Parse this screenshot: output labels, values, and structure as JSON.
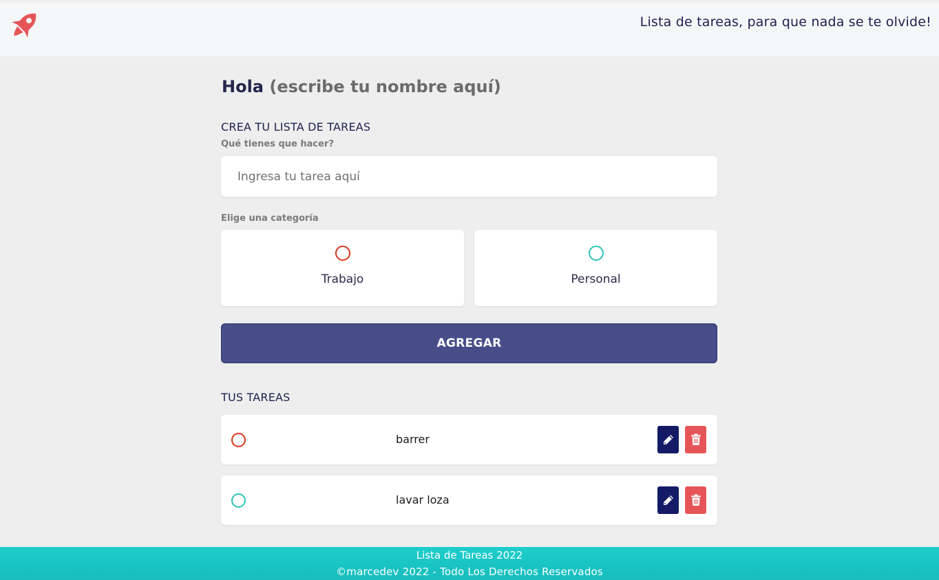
{
  "header": {
    "logo_icon": "rocket-icon",
    "tagline": "Lista de tareas, para que nada se te olvide!",
    "accent_color": "#e55557"
  },
  "greeting": {
    "hello": "Hola",
    "name_placeholder": "(escribe tu nombre aquí)"
  },
  "form": {
    "section_title": "CREA TU LISTA DE TAREAS",
    "task_label": "Qué tienes que hacer?",
    "task_input": {
      "value": "",
      "placeholder": "Ingresa tu tarea aquí"
    },
    "category_label": "Elige una categoría",
    "categories": [
      {
        "label": "Trabajo",
        "color": "#d8351c",
        "selected": false
      },
      {
        "label": "Personal",
        "color": "#2ec4b6",
        "selected": false
      }
    ],
    "add_button": "AGREGAR",
    "button_color": "#474d89"
  },
  "tasks": {
    "section_title": "TUS TAREAS",
    "items": [
      {
        "text": "barrer",
        "category": "Trabajo",
        "color": "#d8351c",
        "edit_icon": "pencil-icon",
        "delete_icon": "trash-icon"
      },
      {
        "text": "lavar loza",
        "category": "Personal",
        "color": "#2ec4b6",
        "edit_icon": "pencil-icon",
        "delete_icon": "trash-icon"
      }
    ]
  },
  "footer": {
    "title": "Lista de Tareas 2022",
    "copyright": "©marcedev 2022 - Todo Los Derechos Reservados",
    "color": "#1dcdcc"
  }
}
